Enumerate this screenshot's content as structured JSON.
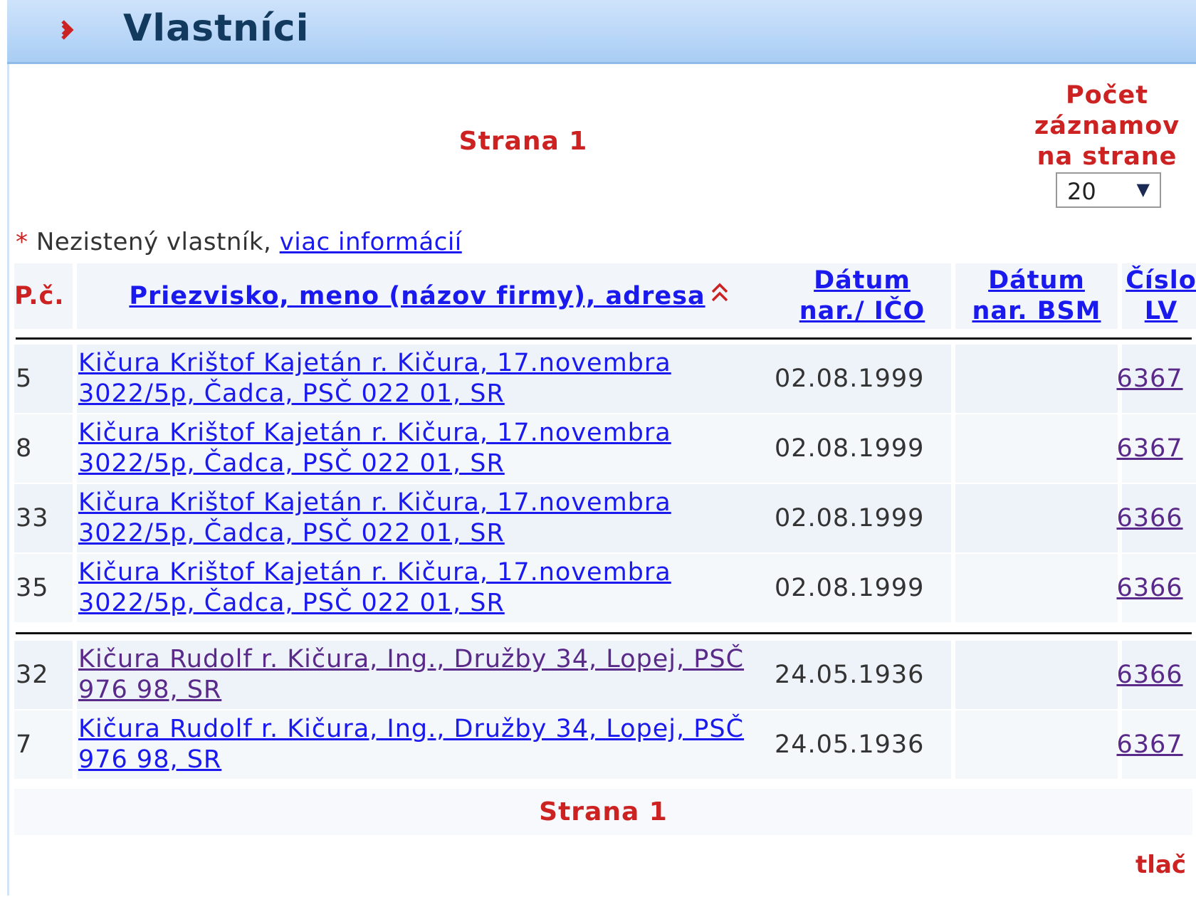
{
  "header": {
    "title": "Vlastníci"
  },
  "pager": {
    "top_label": "Strana 1",
    "bottom_label": "Strana 1",
    "per_page_label": "Počet záznamov na strane",
    "per_page_value": "20"
  },
  "note": {
    "star": "*",
    "text": "Nezistený vlastník,",
    "link": "viac informácií"
  },
  "columns": {
    "pc": "P.č.",
    "name": "Priezvisko, meno (názov firmy), adresa",
    "dat_line1": "Dátum",
    "dat_line2": "nar./ IČO",
    "bsm_line1": "Dátum",
    "bsm_line2": "nar. BSM",
    "lv_line1": "Číslo",
    "lv_line2": "LV"
  },
  "rows": [
    {
      "pc": "5",
      "name_line1": "Kičura Krištof Kajetán r. Kičura, 17.novembra",
      "name_line2": "3022/5p, Čadca, PSČ 022 01, SR",
      "dat": "02.08.1999",
      "bsm": "",
      "lv": "6367"
    },
    {
      "pc": "8",
      "name_line1": "Kičura Krištof Kajetán r. Kičura, 17.novembra",
      "name_line2": "3022/5p, Čadca, PSČ 022 01, SR",
      "dat": "02.08.1999",
      "bsm": "",
      "lv": "6367"
    },
    {
      "pc": "33",
      "name_line1": "Kičura Krištof Kajetán r. Kičura, 17.novembra",
      "name_line2": "3022/5p, Čadca, PSČ 022 01, SR",
      "dat": "02.08.1999",
      "bsm": "",
      "lv": "6366"
    },
    {
      "pc": "35",
      "name_line1": "Kičura Krištof Kajetán r. Kičura, 17.novembra",
      "name_line2": "3022/5p, Čadca, PSČ 022 01, SR",
      "dat": "02.08.1999",
      "bsm": "",
      "lv": "6366"
    },
    {
      "pc": "32",
      "name_line1": "Kičura Rudolf r. Kičura, Ing., Družby 34, Lopej, PSČ",
      "name_line2": "976 98, SR",
      "dat": "24.05.1936",
      "bsm": "",
      "lv": "6366"
    },
    {
      "pc": "7",
      "name_line1": "Kičura Rudolf r. Kičura, Ing., Družby 34, Lopej, PSČ",
      "name_line2": "976 98, SR",
      "dat": "24.05.1936",
      "bsm": "",
      "lv": "6367"
    }
  ],
  "footer": {
    "print_label": "tlač"
  },
  "icons": {
    "header_arrow": "double-chevron-right-icon",
    "sort": "sort-ascending-icon",
    "select_caret": "triangle-down-icon"
  },
  "colors": {
    "accent_red": "#cc2222",
    "link_blue": "#1a1aee",
    "header_bg": "#b8d6f6",
    "title": "#123a5f"
  }
}
